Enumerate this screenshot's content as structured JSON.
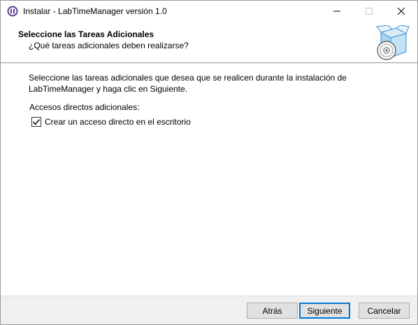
{
  "window": {
    "title": "Instalar - LabTimeManager versión 1.0",
    "icons": {
      "app": "installer-app-icon",
      "minimize": "minimize-icon",
      "maximize": "maximize-icon",
      "close": "close-icon"
    }
  },
  "header": {
    "title": "Seleccione las Tareas Adicionales",
    "subtitle": "¿Qué tareas adicionales deben realizarse?",
    "graphic": "install-box-disc-icon"
  },
  "main": {
    "description": "Seleccione las tareas adicionales que desea que se realicen durante la instalación de LabTimeManager y haga clic en Siguiente.",
    "group_label": "Accesos directos adicionales:",
    "tasks": [
      {
        "label": "Crear un acceso directo en el escritorio",
        "checked": true
      }
    ]
  },
  "footer": {
    "back_label": "Atrás",
    "next_label": "Siguiente",
    "cancel_label": "Cancelar"
  },
  "colors": {
    "accent": "#0078d7",
    "window_bg": "#f0f0f0",
    "panel_bg": "#ffffff"
  }
}
